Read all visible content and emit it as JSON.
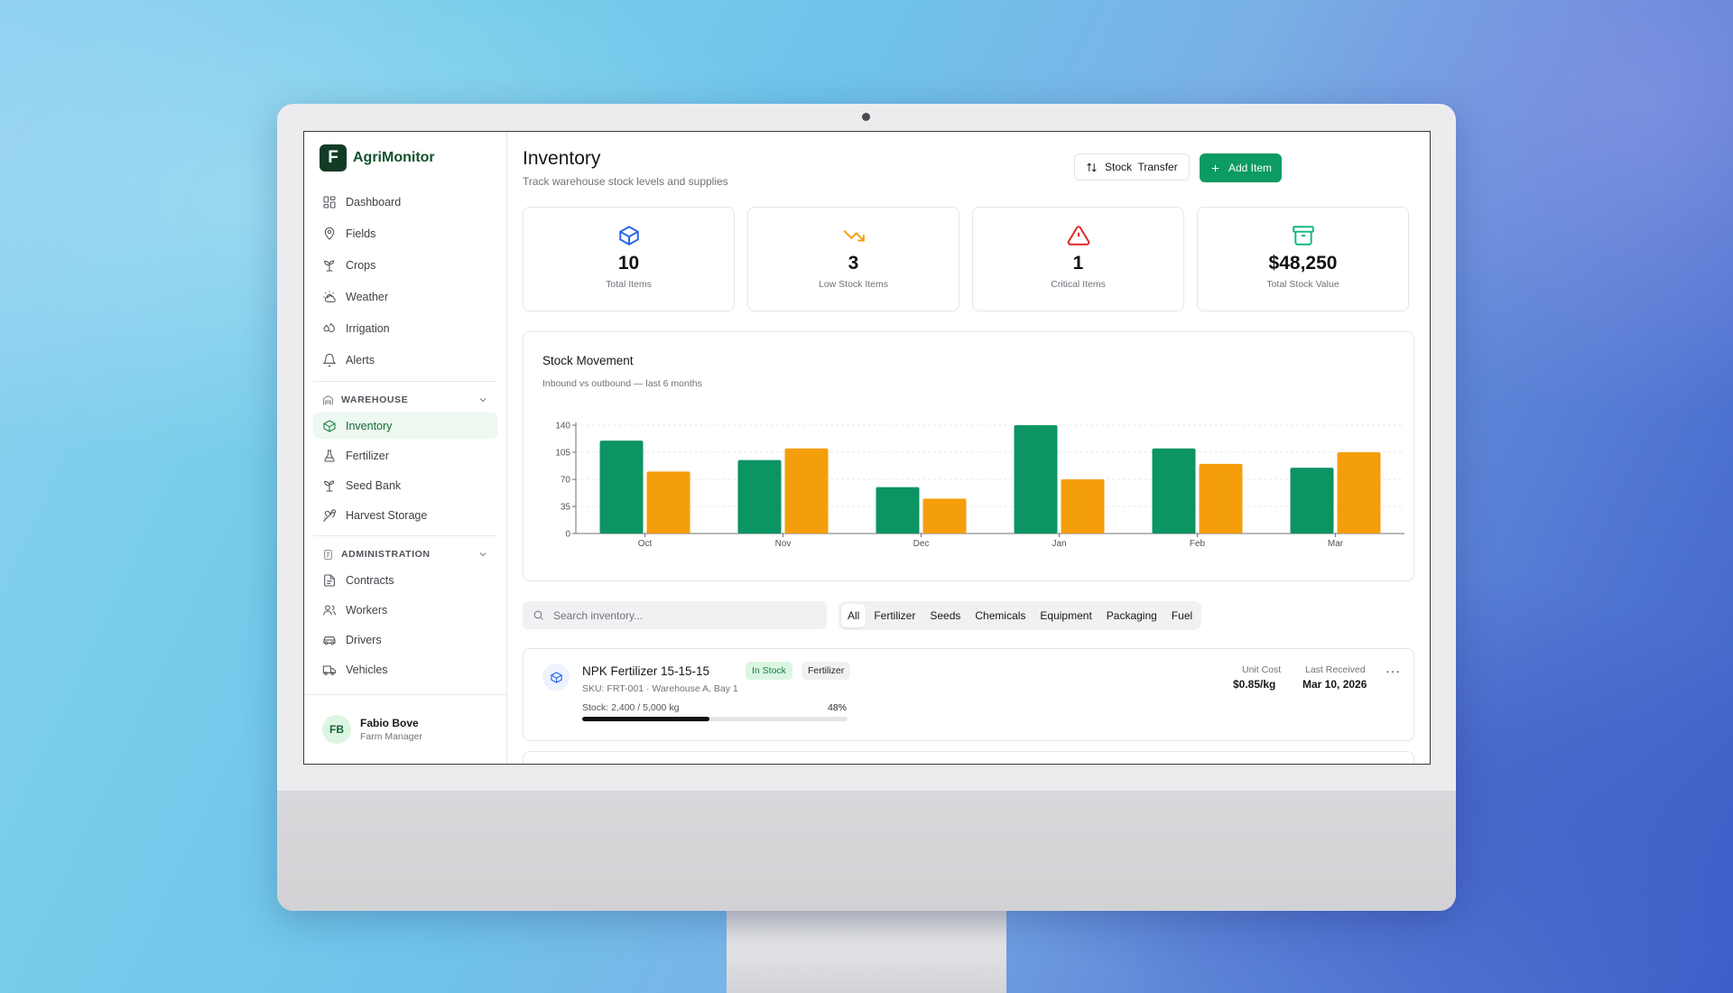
{
  "app": {
    "logo_letter": "F",
    "name": "AgriMonitor"
  },
  "nav": {
    "main": [
      {
        "label": "Dashboard",
        "icon": "dashboard-icon"
      },
      {
        "label": "Fields",
        "icon": "map-pin-icon"
      },
      {
        "label": "Crops",
        "icon": "sprout-icon"
      },
      {
        "label": "Weather",
        "icon": "weather-icon"
      },
      {
        "label": "Irrigation",
        "icon": "droplets-icon"
      },
      {
        "label": "Alerts",
        "icon": "bell-icon"
      }
    ],
    "warehouse": {
      "title": "WAREHOUSE",
      "items": [
        {
          "label": "Inventory",
          "icon": "package-icon",
          "active": true
        },
        {
          "label": "Fertilizer",
          "icon": "flask-icon"
        },
        {
          "label": "Seed Bank",
          "icon": "sprout-icon"
        },
        {
          "label": "Harvest Storage",
          "icon": "wheat-icon"
        }
      ]
    },
    "administration": {
      "title": "ADMINISTRATION",
      "items": [
        {
          "label": "Contracts",
          "icon": "file-icon"
        },
        {
          "label": "Workers",
          "icon": "users-icon"
        },
        {
          "label": "Drivers",
          "icon": "car-icon"
        },
        {
          "label": "Vehicles",
          "icon": "truck-icon"
        }
      ]
    }
  },
  "user": {
    "initials": "FB",
    "name": "Fabio Bove",
    "role": "Farm Manager"
  },
  "header": {
    "title": "Inventory",
    "subtitle": "Track warehouse stock levels and supplies",
    "transfer_label": "Stock  Transfer",
    "add_label": "Add Item"
  },
  "stats": [
    {
      "value": "10",
      "label": "Total Items",
      "icon": "box-icon",
      "color": "#2563eb"
    },
    {
      "value": "3",
      "label": "Low Stock Items",
      "icon": "trending-down-icon",
      "color": "#f59e0b"
    },
    {
      "value": "1",
      "label": "Critical Items",
      "icon": "alert-triangle-icon",
      "color": "#dc2626"
    },
    {
      "value": "$48,250",
      "label": "Total Stock Value",
      "icon": "archive-icon",
      "color": "#10b981"
    }
  ],
  "chart": {
    "title": "Stock Movement",
    "subtitle": "Inbound vs outbound — last 6 months"
  },
  "chart_data": {
    "type": "bar",
    "categories": [
      "Oct",
      "Nov",
      "Dec",
      "Jan",
      "Feb",
      "Mar"
    ],
    "series": [
      {
        "values": [
          120,
          95,
          60,
          140,
          110,
          85
        ],
        "color": "#0c9463"
      },
      {
        "values": [
          80,
          110,
          45,
          70,
          90,
          105
        ],
        "color": "#f59e0b"
      }
    ],
    "yticks": [
      0,
      35,
      70,
      105,
      140
    ],
    "ylim": [
      0,
      140
    ],
    "grid": true
  },
  "search": {
    "placeholder": "Search inventory..."
  },
  "filters": [
    {
      "label": "All",
      "active": true
    },
    {
      "label": "Fertilizer"
    },
    {
      "label": "Seeds"
    },
    {
      "label": "Chemicals"
    },
    {
      "label": "Equipment"
    },
    {
      "label": "Packaging"
    },
    {
      "label": "Fuel"
    }
  ],
  "items": [
    {
      "name": "NPK Fertilizer 15-15-15",
      "status": "In Stock",
      "category": "Fertilizer",
      "sku": "SKU: FRT-001 · Warehouse A, Bay 1",
      "stock_text": "Stock: 2,400 / 5,000 kg",
      "stock_pct": "48%",
      "stock_fraction": 0.48,
      "unit_cost_label": "Unit Cost",
      "unit_cost": "$0.85/kg",
      "last_received_label": "Last Received",
      "last_received": "Mar 10, 2026",
      "more": "···"
    }
  ]
}
